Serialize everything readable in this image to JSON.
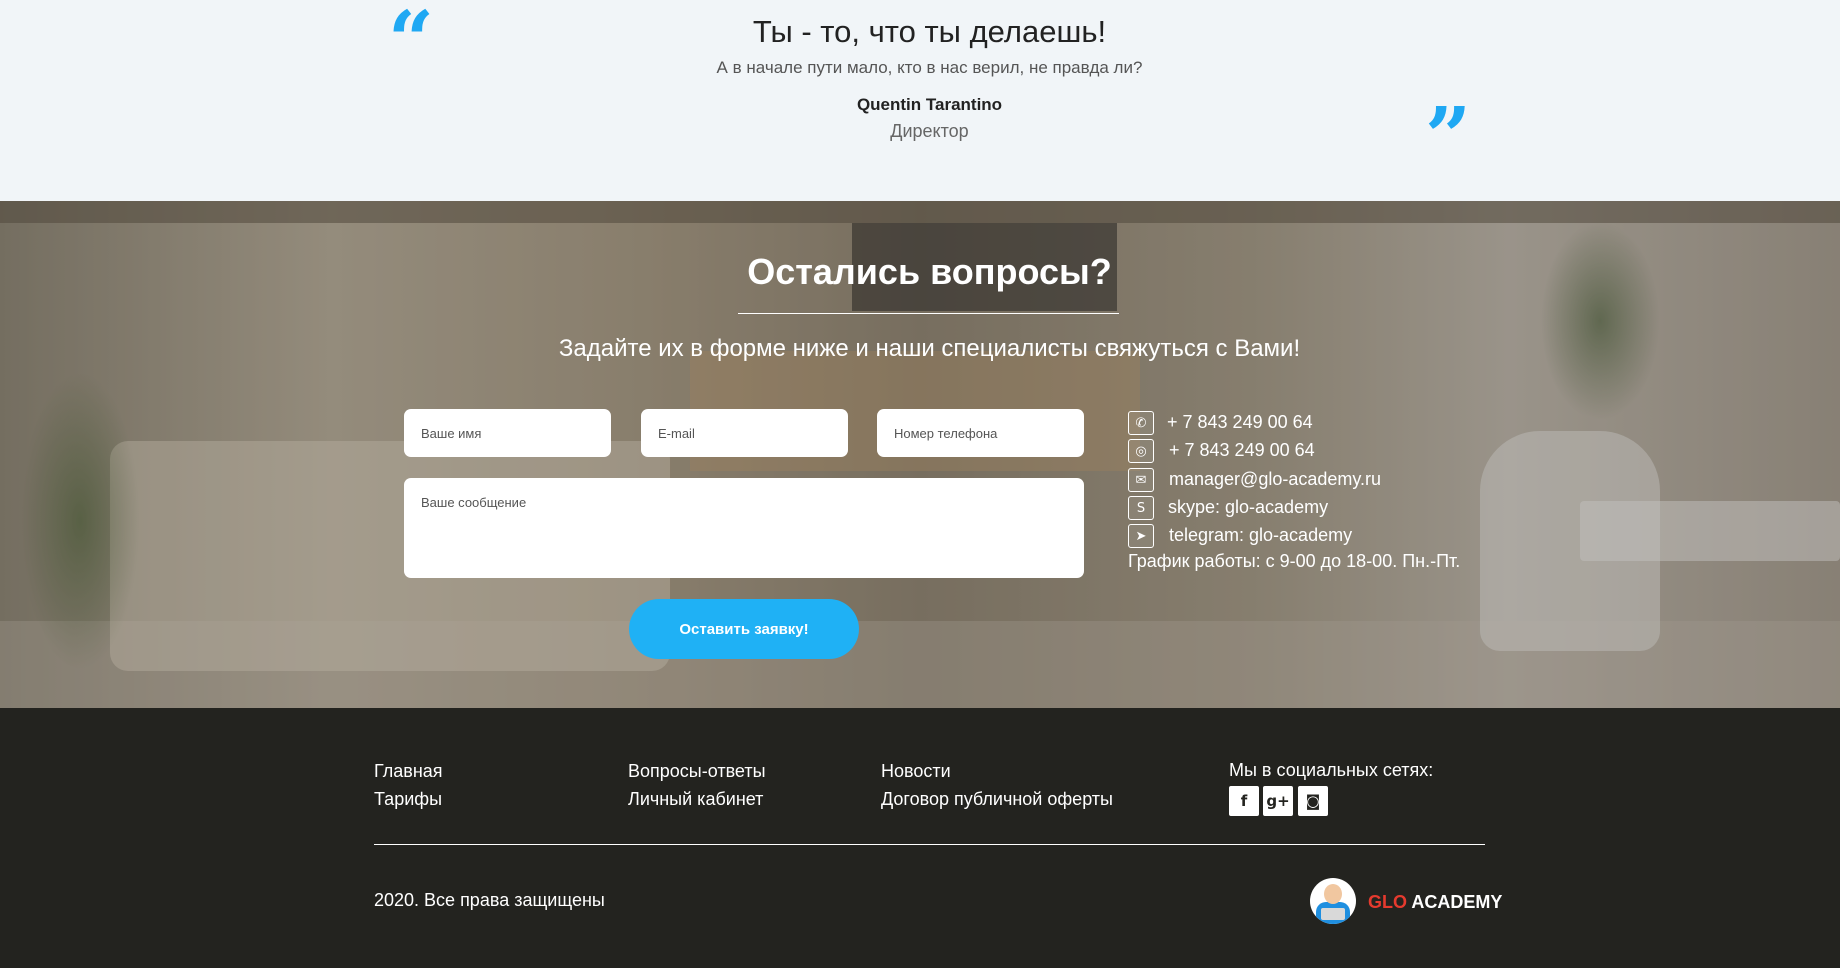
{
  "quote": {
    "title": "Ты - то, что ты делаешь!",
    "subtitle": "А в начале пути мало, кто в нас верил, не правда ли?",
    "author": "Quentin Tarantino",
    "role": "Директор",
    "open_mark": "“",
    "close_mark": "”"
  },
  "contact": {
    "title": "Остались вопросы?",
    "subtitle": "Задайте их в форме ниже и наши специалисты свяжуться с Вами!",
    "form": {
      "name_placeholder": "Ваше имя",
      "email_placeholder": "E-mail",
      "phone_placeholder": "Номер телефона",
      "message_placeholder": "Ваше сообщение",
      "submit_label": "Оставить заявку!"
    },
    "details": [
      {
        "icon": "phone-icon",
        "glyph": "✆",
        "text": "+ 7 843 249 00 64"
      },
      {
        "icon": "whatsapp-icon",
        "glyph": "◎",
        "text": "+ 7 843 249 00 64"
      },
      {
        "icon": "mail-icon",
        "glyph": "✉",
        "text": "manager@glo-academy.ru"
      },
      {
        "icon": "skype-icon",
        "glyph": "S",
        "text": "skype: glo-academy"
      },
      {
        "icon": "telegram-icon",
        "glyph": "➤",
        "text": "telegram: glo-academy"
      }
    ],
    "hours": "График работы: с 9-00 до 18-00. Пн.-Пт."
  },
  "footer": {
    "links": [
      {
        "label": "Главная"
      },
      {
        "label": "Тарифы"
      },
      {
        "label": "Вопросы-ответы"
      },
      {
        "label": "Личный кабинет"
      },
      {
        "label": "Новости"
      },
      {
        "label": "Договор публичной оферты"
      }
    ],
    "social_title": "Мы в социальных сетях:",
    "social": [
      {
        "icon": "facebook-icon",
        "glyph": "f"
      },
      {
        "icon": "google-plus-icon",
        "glyph": "g+"
      },
      {
        "icon": "instagram-icon",
        "glyph": "◙"
      }
    ],
    "copyright": "2020. Все права защищены",
    "logo": {
      "brand_red": "GLO",
      "brand_white": "ACADEMY"
    }
  },
  "colors": {
    "accent": "#1fb1f5",
    "quote_mark": "#1fa8f3",
    "footer_bg": "#23231f",
    "quote_bg": "#f1f5f8",
    "logo_red": "#e53a2e"
  }
}
